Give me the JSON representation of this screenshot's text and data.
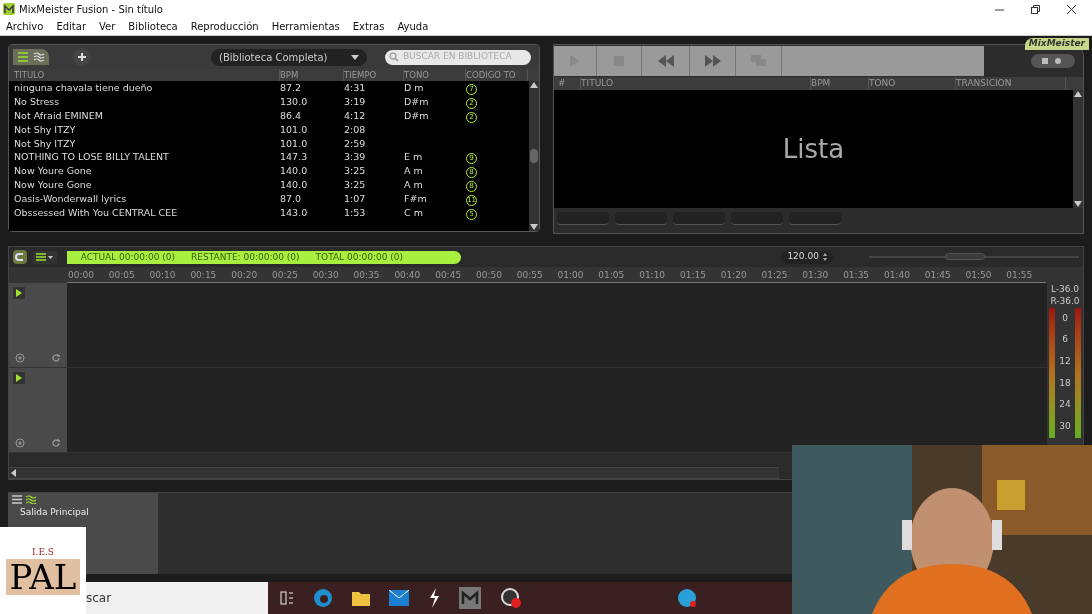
{
  "window": {
    "title": "MixMeister Fusion - Sin título",
    "brand": "MixMeister"
  },
  "menu": [
    "Archivo",
    "Editar",
    "Ver",
    "Biblioteca",
    "Reproducción",
    "Herramientas",
    "Extras",
    "Ayuda"
  ],
  "library": {
    "source": "(Biblioteca Completa)",
    "search_placeholder": "BUSCAR EN BIBLIOTECA",
    "columns": [
      "TITULO",
      "BPM",
      "TIEMPO",
      "TONO",
      "CODIGO TO"
    ],
    "rows": [
      {
        "title": "ninguna chavala tiene dueño",
        "bpm": "87.2",
        "time": "4:31",
        "key": "D m",
        "code": "7"
      },
      {
        "title": "No Stress",
        "bpm": "130.0",
        "time": "3:19",
        "key": "D#m",
        "code": "2"
      },
      {
        "title": "Not Afraid EMINEM",
        "bpm": "86.4",
        "time": "4:12",
        "key": "D#m",
        "code": "2"
      },
      {
        "title": "Not Shy ITZY",
        "bpm": "101.0",
        "time": "2:08"
      },
      {
        "title": "Not Shy ITZY",
        "bpm": "101.0",
        "time": "2:59"
      },
      {
        "title": "NOTHING TO LOSE BILLY TALENT",
        "bpm": "147.3",
        "time": "3:39",
        "key": "E m",
        "code": "9"
      },
      {
        "title": "Now Youre Gone",
        "bpm": "140.0",
        "time": "3:25",
        "key": "A m",
        "code": "8"
      },
      {
        "title": "Now Youre Gone",
        "bpm": "140.0",
        "time": "3:25",
        "key": "A m",
        "code": "8"
      },
      {
        "title": "Oasis-Wonderwall lyrics",
        "bpm": "87.0",
        "time": "1:07",
        "key": "F#m",
        "code": "11"
      },
      {
        "title": "Obssessed With You CENTRAL CEE",
        "bpm": "143.0",
        "time": "1:53",
        "key": "C m",
        "code": "5"
      }
    ]
  },
  "playlist": {
    "columns": [
      "#",
      "TITULO",
      "BPM",
      "TONO",
      "TRANSICION"
    ],
    "empty_label": "Lista"
  },
  "timeline": {
    "status": [
      "ACTUAL 00:00:00 (0)",
      "RESTANTE: 00:00:00 (0)",
      "TOTAL 00:00:00 (0)"
    ],
    "tempo": "120.00",
    "zoom": {
      "level": 0.45
    },
    "ticks": [
      "00:00",
      "00:05",
      "00:10",
      "00:15",
      "00:20",
      "00:25",
      "00:30",
      "00:35",
      "00:40",
      "00:45",
      "00:50",
      "00:55",
      "01:00",
      "01:05",
      "01:10",
      "01:15",
      "01:20",
      "01:25",
      "01:30",
      "01:35",
      "01:40",
      "01:45",
      "01:50",
      "01:55"
    ],
    "meter": {
      "left": "L-36.0",
      "right": "R-36.0",
      "scale": [
        "0",
        "6",
        "12",
        "18",
        "24",
        "30"
      ]
    }
  },
  "output": {
    "label": "Salida Principal"
  },
  "taskbar": {
    "search": "scar"
  },
  "logo": {
    "top": "I.E.S",
    "main": "PAL"
  }
}
